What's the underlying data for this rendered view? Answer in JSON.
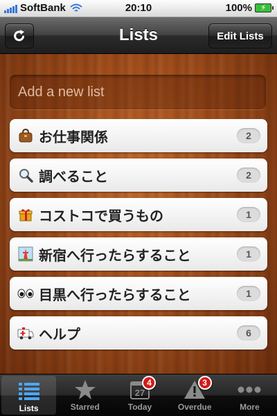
{
  "status_bar": {
    "carrier": "SoftBank",
    "time": "20:10",
    "battery": "100%"
  },
  "navbar": {
    "title": "Lists",
    "edit_label": "Edit Lists"
  },
  "add_list": {
    "placeholder": "Add a new list"
  },
  "lists": [
    {
      "label": "お仕事関係",
      "count": "2",
      "icon": "briefcase-icon"
    },
    {
      "label": "調べること",
      "count": "2",
      "icon": "magnifier-icon"
    },
    {
      "label": "コストコで買うもの",
      "count": "1",
      "icon": "gift-icon"
    },
    {
      "label": "新宿へ行ったらすること",
      "count": "1",
      "icon": "tower-icon"
    },
    {
      "label": "目黒へ行ったらすること",
      "count": "1",
      "icon": "eyes-icon"
    },
    {
      "label": "ヘルプ",
      "count": "6",
      "icon": "ambulance-icon"
    }
  ],
  "tabbar": {
    "tabs": [
      {
        "label": "Lists",
        "active": true
      },
      {
        "label": "Starred"
      },
      {
        "label": "Today",
        "badge": "4",
        "calendar_day": "27"
      },
      {
        "label": "Overdue",
        "badge": "3"
      },
      {
        "label": "More"
      }
    ]
  },
  "colors": {
    "wood": "#a24e1b",
    "badge": "#d41a1a",
    "signal": "#3a78d8",
    "battery": "#38c038"
  }
}
